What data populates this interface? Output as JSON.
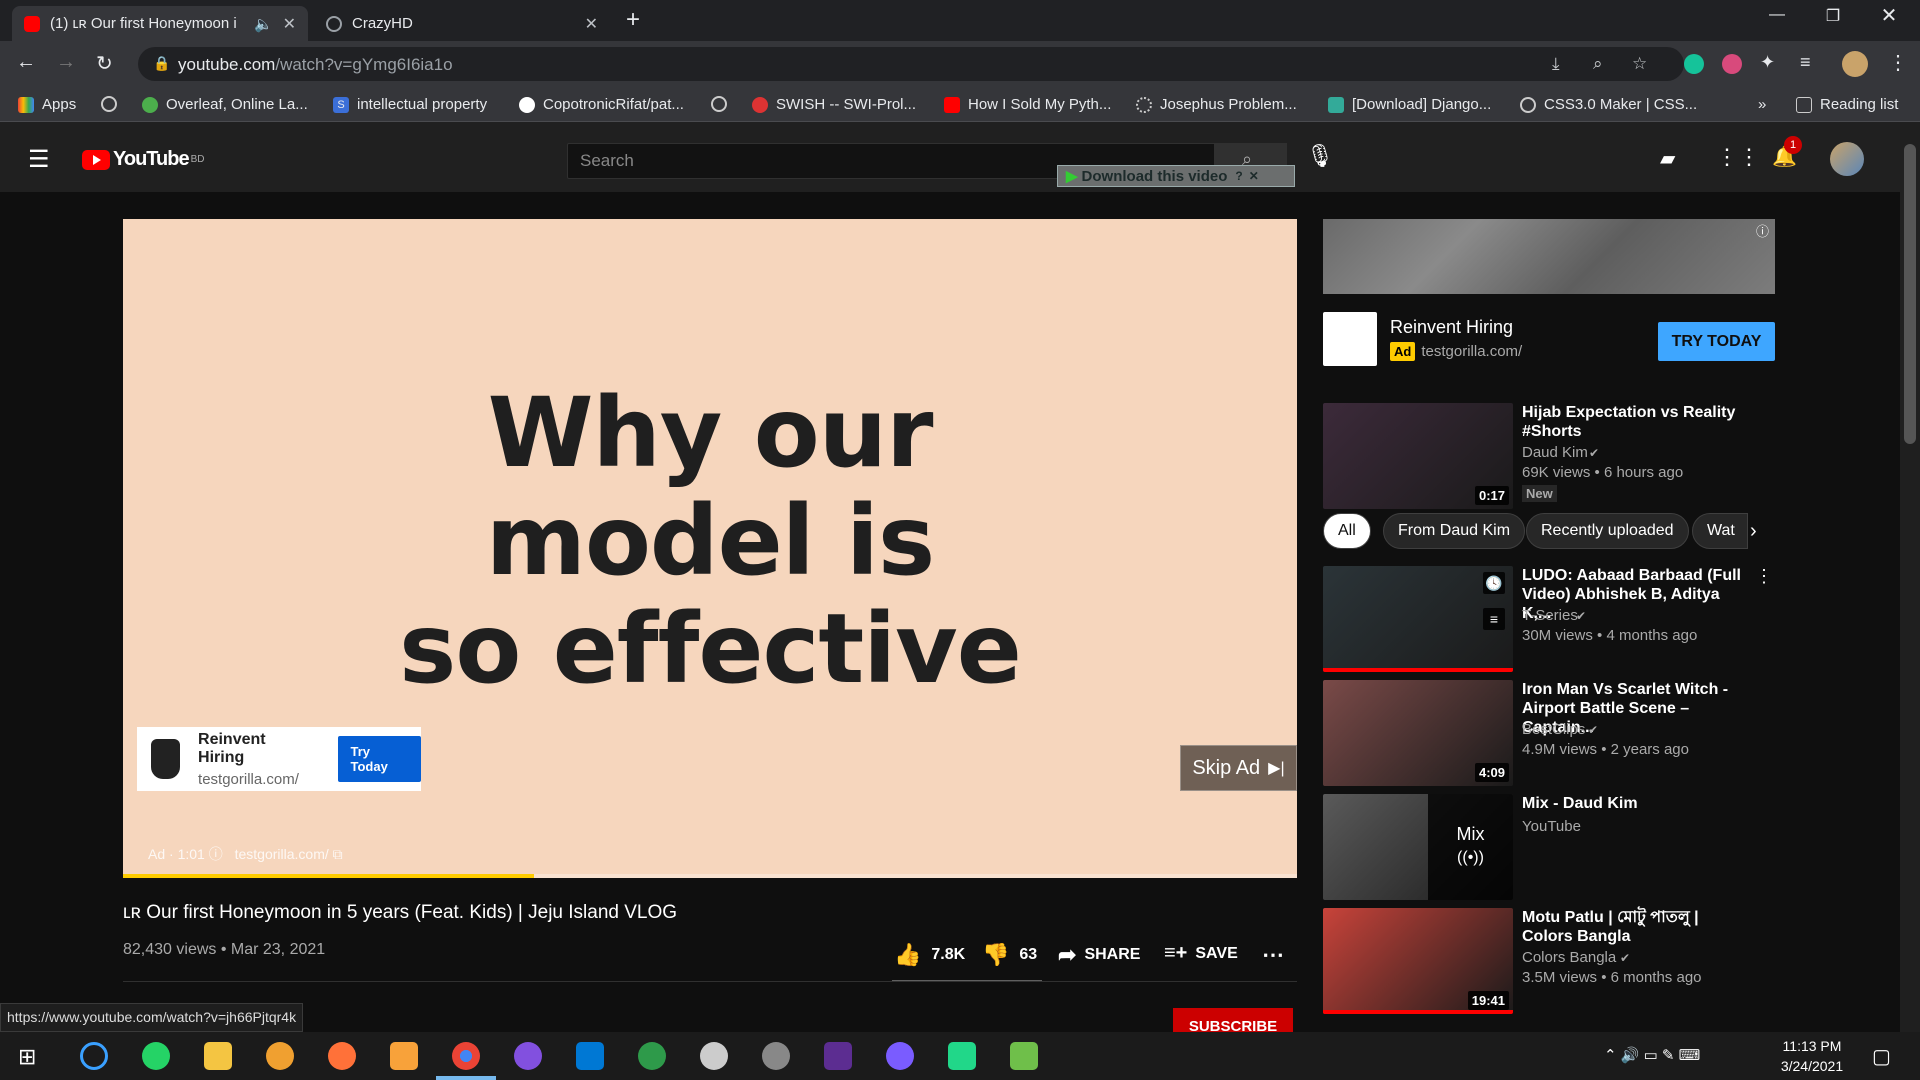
{
  "browser": {
    "tabs": [
      {
        "label": "(1) ʟʀ Our first Honeymoon i",
        "active": true
      },
      {
        "label": "CrazyHD",
        "active": false
      }
    ],
    "url_host": "youtube.com",
    "url_path": "/watch?v=gYmg6I6ia1o",
    "bookmarks": [
      "Apps",
      "Overleaf, Online La...",
      "intellectual property",
      "CopotronicRifat/pat...",
      "SWISH -- SWI-Prol...",
      "How I Sold My Pyth...",
      "Josephus Problem...",
      "[Download] Django...",
      "CSS3.0 Maker | CSS...",
      "Reading list"
    ],
    "status_url": "https://www.youtube.com/watch?v=jh66Pjtqr4k"
  },
  "youtube": {
    "logo": "YouTube",
    "country": "BD",
    "search_placeholder": "Search",
    "download_label": "Download this video",
    "notif_count": "1"
  },
  "ad": {
    "headline": "Why our model is so effective",
    "line1": "Why our",
    "line2": "model is",
    "line3": "so effective",
    "card_title": "Reinvent Hiring",
    "card_url": "testgorilla.com/",
    "card_cta": "Try Today",
    "skip_label": "Skip Ad",
    "info_time": "Ad · 1:01",
    "info_url": "testgorilla.com/",
    "progress": 0.35
  },
  "video": {
    "title": "ʟʀ Our first Honeymoon in 5 years (Feat. Kids) | Jeju Island VLOG",
    "stats": "82,430 views • Mar 23, 2021",
    "likes": "7.8K",
    "dislikes": "63",
    "share": "SHARE",
    "save": "SAVE",
    "subscribe": "SUBSCRIBE"
  },
  "sidebar_ad": {
    "title": "Reinvent Hiring",
    "badge": "Ad",
    "url": "testgorilla.com/",
    "cta": "TRY TODAY"
  },
  "chips": [
    "All",
    "From Daud Kim",
    "Recently uploaded",
    "Wat"
  ],
  "videos": [
    {
      "title": "Hijab Expectation vs Reality #Shorts",
      "channel": "Daud Kim",
      "stats": "69K views • 6 hours ago",
      "badge": "New",
      "duration": "0:17",
      "color": "#3c2a3a"
    },
    {
      "title": "LUDO: Aabaad Barbaad (Full Video) Abhishek B, Aditya K,...",
      "channel": "T-Series",
      "stats": "30M views • 4 months ago",
      "duration": "",
      "color": "#2b3438"
    },
    {
      "title": "Iron Man Vs Scarlet Witch - Airport Battle Scene – Captain...",
      "channel": "BestClips",
      "stats": "4.9M views • 2 years ago",
      "duration": "4:09",
      "color": "#7a4a48"
    },
    {
      "title": "Mix - Daud Kim",
      "channel": "YouTube",
      "stats": "",
      "duration": "",
      "color": "#5a5a5a",
      "mix": "Mix"
    },
    {
      "title": "Motu Patlu | মোটু পাতলু | Colors Bangla",
      "channel": "Colors Bangla",
      "stats": "3.5M views • 6 months ago",
      "duration": "19:41",
      "color": "#c8433a"
    }
  ],
  "taskbar": {
    "time": "11:13 PM",
    "date": "3/24/2021"
  }
}
